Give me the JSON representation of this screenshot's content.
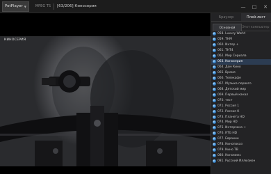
{
  "titlebar": {
    "app_name": "PotPlayer",
    "format": "MPEG TS",
    "title": "[63/206] Киносерия",
    "minimize_glyph": "—",
    "maximize_glyph": "□",
    "close_glyph": "✕"
  },
  "video": {
    "channel_logo": "КИНОСЕРИЯ"
  },
  "panel": {
    "tabs": [
      {
        "label": "Браузер",
        "active": false
      },
      {
        "label": "Плей-лист",
        "active": true
      }
    ],
    "subtabs": [
      {
        "label": "Основной",
        "active": true
      },
      {
        "label": "Этот компьютер",
        "active": false
      }
    ],
    "items": [
      {
        "label": "058. Luxury World"
      },
      {
        "label": "059. ТНМ"
      },
      {
        "label": "060. Интер +"
      },
      {
        "label": "061. ТНТ4"
      },
      {
        "label": "062. Мир Сериала"
      },
      {
        "label": "063. Киносерия",
        "active": true
      },
      {
        "label": "064. Дом Кино"
      },
      {
        "label": "065. Время"
      },
      {
        "label": "066. Телекафе"
      },
      {
        "label": "067. Музыка первого"
      },
      {
        "label": "068. Детский мир"
      },
      {
        "label": "069. Первый канал"
      },
      {
        "label": "070. тест"
      },
      {
        "label": "071. Россия 1"
      },
      {
        "label": "072. Россия К"
      },
      {
        "label": "073. Планета HD"
      },
      {
        "label": "074. Мир HD"
      },
      {
        "label": "075. Интерзона +"
      },
      {
        "label": "076. RTG HD"
      },
      {
        "label": "077. Евроинн"
      },
      {
        "label": "078. Кинопоказ"
      },
      {
        "label": "079. Кино ТВ"
      },
      {
        "label": "080. Киномикс"
      },
      {
        "label": "081. Русский Иллюзион"
      }
    ]
  }
}
